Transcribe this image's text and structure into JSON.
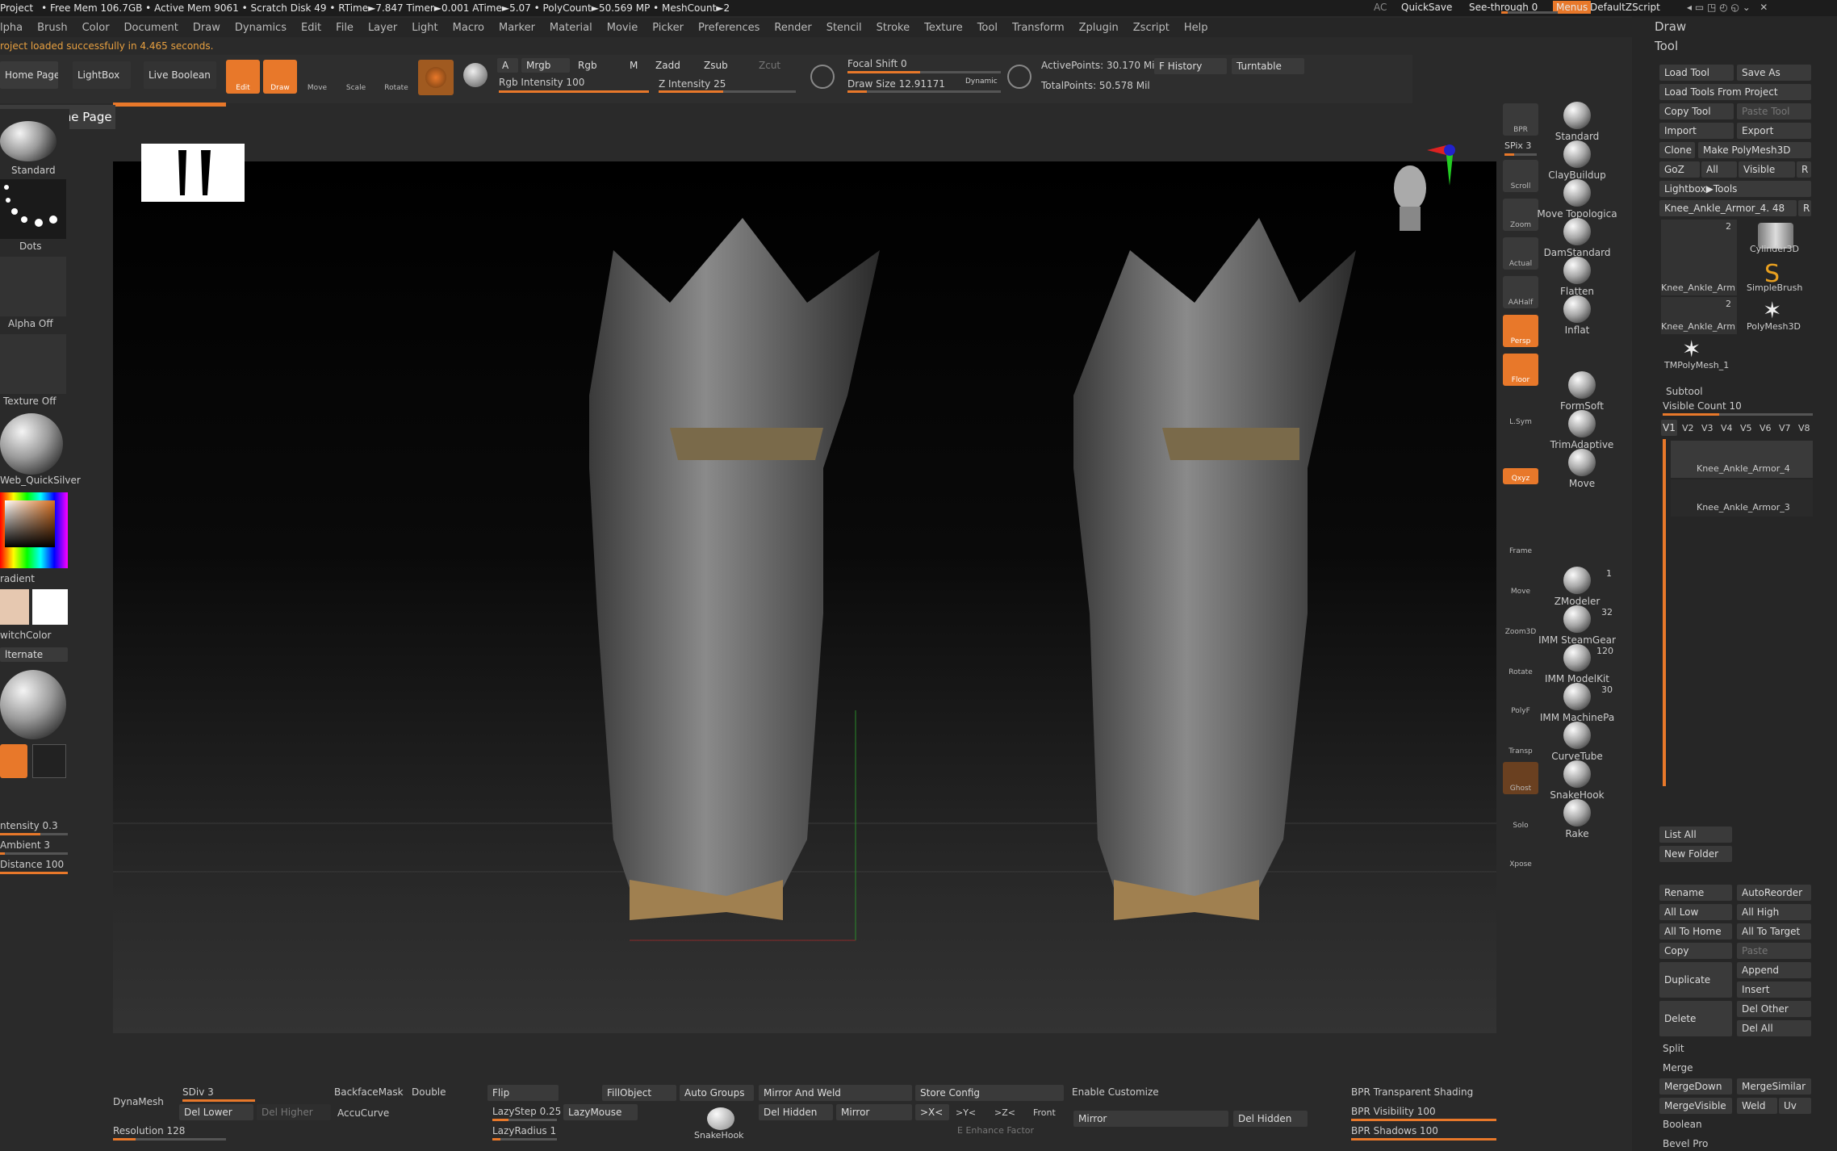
{
  "status_bar": {
    "project": "Project",
    "stats": "• Free Mem 106.7GB • Active Mem 9061 • Scratch Disk 49 • RTime►7.847 Timer►0.001 ATime►5.07 • PolyCount►50.569 MP • MeshCount►2",
    "ac": "AC",
    "quicksave": "QuickSave",
    "see_through": "See-through  0",
    "menus": "Menus",
    "script": "DefaultZScript"
  },
  "menu": [
    "lpha",
    "Brush",
    "Color",
    "Document",
    "Draw",
    "Dynamics",
    "Edit",
    "File",
    "Layer",
    "Light",
    "Macro",
    "Marker",
    "Material",
    "Movie",
    "Picker",
    "Preferences",
    "Render",
    "Stencil",
    "Stroke",
    "Texture",
    "Tool",
    "Transform",
    "Zplugin",
    "Zscript",
    "Help"
  ],
  "notify": "roject loaded successfully in 4.465 seconds.",
  "tabs": {
    "home": "Home Page",
    "lightbox": "LightBox",
    "live_boolean": "Live Boolean",
    "tooltip": "Show Home Page"
  },
  "tools": {
    "edit": "Edit",
    "draw": "Draw",
    "move": "Move",
    "scale": "Scale",
    "rotate": "Rotate"
  },
  "modes": {
    "a": "A",
    "mrgb": "Mrgb",
    "rgb": "Rgb",
    "m": "M",
    "zadd": "Zadd",
    "zsub": "Zsub",
    "zcut": "Zcut",
    "rgb_intensity": "Rgb Intensity 100",
    "z_intensity": "Z Intensity 25",
    "focal": "Focal Shift 0",
    "draw_size": "Draw Size 12.91171",
    "dynamic": "Dynamic",
    "active_points": "ActivePoints: 30.170 Mil",
    "total_points": "TotalPoints: 50.578 Mil",
    "fhistory": "F History",
    "turntable": "Turntable"
  },
  "left": {
    "standard": "Standard",
    "dots": "Dots",
    "alpha_off": "Alpha Off",
    "texture_off": "Texture Off",
    "material": "Web_QuickSilver",
    "gradient": "radient",
    "switch_color": "witchColor",
    "alternate": "lternate",
    "intensity": "ntensity 0.3",
    "ambient": "Ambient 3",
    "distance": "Distance 100"
  },
  "shelf": {
    "bpr": "BPR",
    "spix": "SPix 3",
    "scroll": "Scroll",
    "zoom": "Zoom",
    "actual": "Actual",
    "aahalf": "AAHalf",
    "persp": "Persp",
    "floor": "Floor",
    "lsym": "L.Sym",
    "xyz": "Qxyz",
    "frame": "Frame",
    "move": "Move",
    "zoom3d": "Zoom3D",
    "rotate": "Rotate",
    "linefill": "PolyF",
    "transp": "Transp",
    "ghost": "Ghost",
    "solo": "Solo",
    "xpose": "Xpose"
  },
  "brushes": [
    "Standard",
    "ClayBuildup",
    "Move Topologica",
    "DamStandard",
    "Flatten",
    "Inflat",
    "FormSoft",
    "TrimAdaptive",
    "Move"
  ],
  "insert_brushes": [
    {
      "name": "ZModeler",
      "count": "1"
    },
    {
      "name": "IMM SteamGear",
      "count": "32"
    },
    {
      "name": "IMM ModelKit",
      "count": "120"
    },
    {
      "name": "IMM MachinePa",
      "count": "30"
    },
    {
      "name": "CurveTube",
      "count": ""
    },
    {
      "name": "SnakeHook",
      "count": ""
    },
    {
      "name": "Rake",
      "count": ""
    }
  ],
  "right": {
    "draw": "Draw",
    "tool": "Tool",
    "load_tool": "Load Tool",
    "save_as": "Save As",
    "load_from_project": "Load Tools From Project",
    "copy_tool": "Copy Tool",
    "paste_tool": "Paste Tool",
    "import": "Import",
    "export": "Export",
    "clone": "Clone",
    "make_polymesh": "Make PolyMesh3D",
    "goz": "GoZ",
    "all": "All",
    "visible": "Visible",
    "r": "R",
    "lightbox_tools": "Lightbox▶Tools",
    "current_tool": "Knee_Ankle_Armor_4. 48",
    "tool_thumbs": [
      {
        "name": "Knee_Ankle_Arm",
        "count": "2"
      },
      {
        "name": "Cylinder3D",
        "count": ""
      },
      {
        "name": "Knee_Ankle_Arm",
        "count": "2"
      },
      {
        "name": "SimpleBrush",
        "count": ""
      },
      {
        "name": "TMPolyMesh_1",
        "count": ""
      },
      {
        "name": "PolyMesh3D",
        "count": ""
      }
    ],
    "subtool": "Subtool",
    "visible_count": "Visible Count 10",
    "views": [
      "V1",
      "V2",
      "V3",
      "V4",
      "V5",
      "V6",
      "V7",
      "V8"
    ],
    "subtools": [
      "Knee_Ankle_Armor_4",
      "Knee_Ankle_Armor_3"
    ],
    "list_all": "List All",
    "new_folder": "New Folder",
    "rename": "Rename",
    "autoreorder": "AutoReorder",
    "all_low": "All Low",
    "all_high": "All High",
    "all_to_home": "All To Home",
    "all_to_target": "All To Target",
    "copy": "Copy",
    "paste": "Paste",
    "duplicate": "Duplicate",
    "append": "Append",
    "insert": "Insert",
    "delete": "Delete",
    "del_other": "Del Other",
    "del_all": "Del All",
    "split": "Split",
    "merge": "Merge",
    "mergedown": "MergeDown",
    "mergesimilar": "MergeSimilar",
    "mergevisible": "MergeVisible",
    "weld": "Weld",
    "uv": "Uv",
    "boolean": "Boolean",
    "bevel_pro": "Bevel Pro"
  },
  "bottom": {
    "dynamesh": "DynaMesh",
    "sdiv": "SDiv 3",
    "del_lower": "Del Lower",
    "del_higher": "Del Higher",
    "resolution": "Resolution 128",
    "backfacemask": "BackfaceMask",
    "double": "Double",
    "accucurve": "AccuCurve",
    "flip": "Flip",
    "lazystep": "LazyStep 0.25",
    "lazymouse": "LazyMouse",
    "lazyradius": "LazyRadius 1",
    "fillobject": "FillObject",
    "auto_groups": "Auto Groups",
    "snakehook": "SnakeHook",
    "mirror_weld": "Mirror And Weld",
    "del_hidden": "Del Hidden",
    "mirror": "Mirror",
    "store_config": "Store Config",
    "x": ">X<",
    "y": ">Y<",
    "z": ">Z<",
    "front": "Front",
    "e_enhance": "E Enhance Factor",
    "mirror2": "Mirror",
    "del_hidden2": "Del Hidden",
    "enable_customize": "Enable Customize",
    "bpr_transparent": "BPR Transparent Shading",
    "bpr_visibility": "BPR Visibility 100",
    "bpr_shadows": "BPR Shadows 100"
  }
}
